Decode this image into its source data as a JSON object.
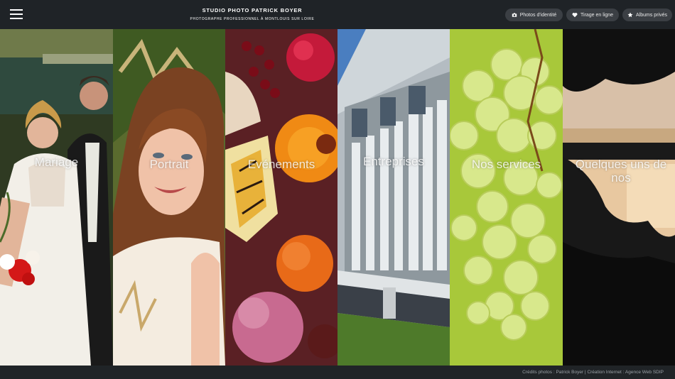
{
  "header": {
    "title": "STUDIO PHOTO PATRICK BOYER",
    "subtitle": "PHOTOGRAPHE PROFESSIONNEL À MONTLOUIS SUR LOIRE",
    "menu_icon": "hamburger-menu-icon",
    "buttons": [
      {
        "label": "Photos d'identité",
        "icon": "camera-icon"
      },
      {
        "label": "Tirage en ligne",
        "icon": "heart-icon"
      },
      {
        "label": "Albums privés",
        "icon": "star-icon"
      }
    ]
  },
  "panels": [
    {
      "label": "Mariage"
    },
    {
      "label": "Portrait"
    },
    {
      "label": "Evénements"
    },
    {
      "label": "Entreprises"
    },
    {
      "label": "Nos services"
    },
    {
      "label": "Quelques uns de nos"
    }
  ],
  "footer": {
    "credits_label": "Crédits photos",
    "credits_name": "Patrick Boyer",
    "creation_label": "Création Internet",
    "agency": "Agence Web SDIP"
  }
}
